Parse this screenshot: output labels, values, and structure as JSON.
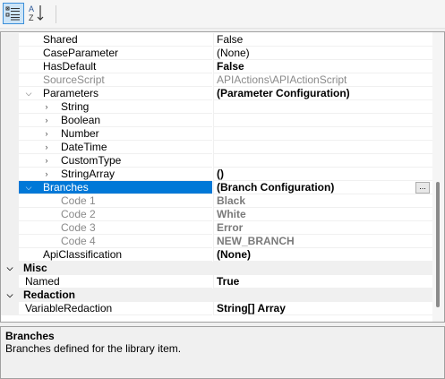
{
  "toolbar": {
    "categorized_icon": "categorized-view-icon",
    "alphabetical_icon": "alphabetical-sort-icon",
    "alpha_top": "A",
    "alpha_bottom": "Z"
  },
  "rows": [
    {
      "name": "Shared",
      "value": "False"
    },
    {
      "name": "CaseParameter",
      "value": "(None)"
    },
    {
      "name": "HasDefault",
      "value": "False"
    },
    {
      "name": "SourceScript",
      "value": "APIActions\\APIActionScript"
    },
    {
      "name": "Parameters",
      "value": "(Parameter Configuration)"
    },
    {
      "name": "String",
      "value": ""
    },
    {
      "name": "Boolean",
      "value": ""
    },
    {
      "name": "Number",
      "value": ""
    },
    {
      "name": "DateTime",
      "value": ""
    },
    {
      "name": "CustomType",
      "value": ""
    },
    {
      "name": "StringArray",
      "value": "()"
    },
    {
      "name": "Branches",
      "value": "(Branch Configuration)",
      "button": "..."
    },
    {
      "name": "Code 1",
      "value": "Black"
    },
    {
      "name": "Code 2",
      "value": "White"
    },
    {
      "name": "Code 3",
      "value": "Error"
    },
    {
      "name": "Code 4",
      "value": "NEW_BRANCH"
    },
    {
      "name": "ApiClassification",
      "value": "(None)"
    }
  ],
  "categories": {
    "misc": "Misc",
    "redaction": "Redaction"
  },
  "misc_rows": [
    {
      "name": "Named",
      "value": "True"
    }
  ],
  "redaction_rows": [
    {
      "name": "VariableRedaction",
      "value": "String[] Array"
    }
  ],
  "description": {
    "title": "Branches",
    "text": "Branches defined for the library item."
  },
  "colors": {
    "selection": "#0078d7",
    "toolbar_active": "#cce4f7"
  }
}
